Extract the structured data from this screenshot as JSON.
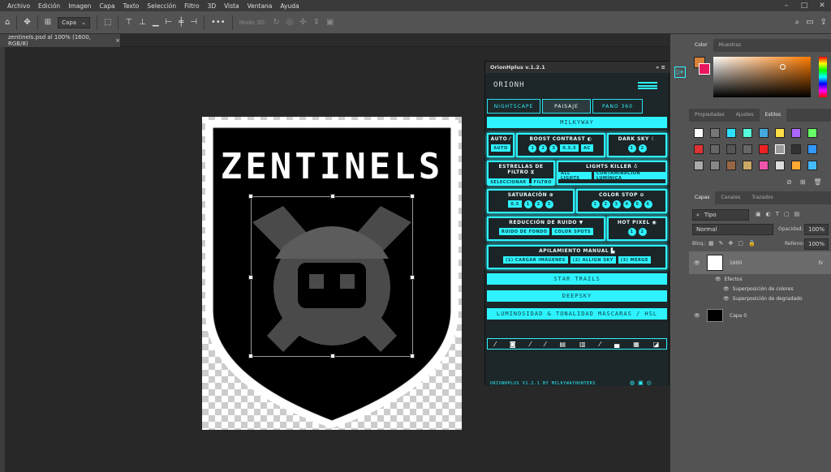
{
  "menu": [
    "Archivo",
    "Edición",
    "Imagen",
    "Capa",
    "Texto",
    "Selección",
    "Filtro",
    "3D",
    "Vista",
    "Ventana",
    "Ayuda"
  ],
  "options": {
    "layer_select": "Capa",
    "mode3d": "Modo 3D:"
  },
  "document": {
    "tab_title": "zentinels.psd al 100% (1600, RGB/8)",
    "close": "×",
    "main_text": "ZENTINELS"
  },
  "plugin": {
    "title": "OrionHplus v.1.2.1",
    "logo": "ORIONH",
    "tabs": [
      "NIGHTSCAPE",
      "PAISAJE",
      "PANO 360"
    ],
    "milkyway": "MILKYWAY",
    "auto": {
      "label": "AUTO",
      "chip": "AUTO"
    },
    "boost": {
      "label": "BOOST CONTRAST",
      "dots": [
        "1",
        "2",
        "3"
      ],
      "chips": [
        "0.5.5",
        "AC"
      ]
    },
    "darksky": {
      "label": "DARK SKY",
      "dots": [
        "1",
        "2"
      ]
    },
    "estrellas": {
      "label": "ESTRELLAS DE FILTRO",
      "chips": [
        "SELECCIONAR",
        "FILTRO"
      ]
    },
    "lights": {
      "label": "LIGHTS KILLER",
      "chips": [
        "ALL LIGHTS",
        "CONTAMINACIÓN LUMÍNICA"
      ]
    },
    "saturacion": {
      "label": "SATURACIÓN",
      "chip": "0.5",
      "dots": [
        "1",
        "2",
        "3"
      ]
    },
    "colorstop": {
      "label": "COLOR STOP",
      "dots": [
        "1",
        "2",
        "3",
        "4",
        "5",
        "6"
      ]
    },
    "ruido": {
      "label": "REDUCCIÓN DE RUIDO",
      "chips": [
        "RUIDO DE FONDO",
        "COLOR SPOTS"
      ]
    },
    "hotpixel": {
      "label": "HOT PIXEL",
      "dots": [
        "1",
        "2"
      ]
    },
    "apilamiento": {
      "label": "APILAMIENTO MANUAL",
      "chips": [
        "(1) CARGAR IMÁGENES",
        "(2) ALLIGN SKY",
        "(3) MERGE"
      ]
    },
    "startrails": "STAR TRAILS",
    "deepsky": "DEEPSKY",
    "luminosidad": "LUMINOSIDAD & TONALIDAD MÁSCARAS / HSL",
    "footer": "ORIONHPLUS V1.2.1 BY MILKYWAYHUNTERS"
  },
  "panels": {
    "color_tabs": [
      "Color",
      "Muestras"
    ],
    "props_tabs": [
      "Propiedades",
      "Ajustes",
      "Estilos"
    ],
    "layers_tabs": [
      "Capas",
      "Canales",
      "Trazados"
    ],
    "kind": "Tipo",
    "blend": "Normal",
    "opacity_label": "Opacidad:",
    "opacity": "100%",
    "lock_label": "Bloq.:",
    "fill_label": "Relleno:",
    "fill": "100%",
    "layers": [
      {
        "name": "1600",
        "fx": "fx"
      },
      {
        "name": "Efectos"
      },
      {
        "name": "Superposición de colores"
      },
      {
        "name": "Superposición de degradado"
      },
      {
        "name": "Capa 0"
      }
    ]
  },
  "colors": {
    "accent": "#2ef3ff",
    "fg": "#d8823a",
    "bg": "#e9175f"
  }
}
